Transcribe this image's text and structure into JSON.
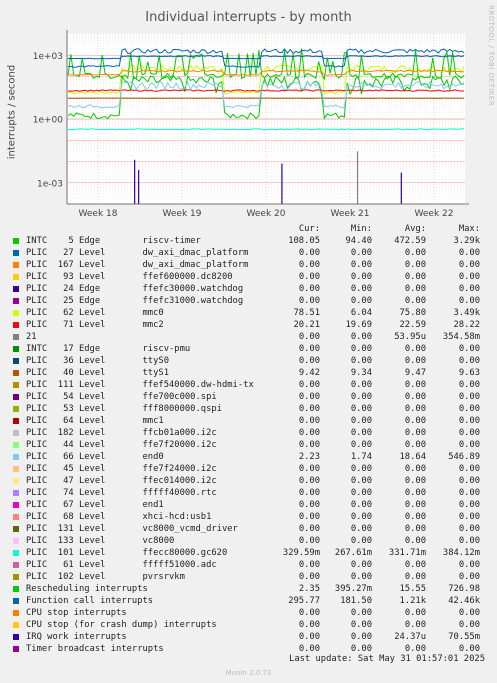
{
  "title": "Individual interrupts - by month",
  "side_credit": "RRDTOOL / TOBI OETIKER",
  "ylabel": "interrupts / second",
  "columns": {
    "cur": "Cur:",
    "min": "Min:",
    "avg": "Avg:",
    "max": "Max:"
  },
  "last_update": "Last update: Sat May 31 01:57:01 2025",
  "version": "Munin 2.0.73",
  "chart_data": {
    "type": "line",
    "title": "Individual interrupts - by month",
    "ylabel": "interrupts / second",
    "yscale": "log",
    "ylim": [
      0.0001,
      10000
    ],
    "yticks": [
      "1e+03",
      "1e+00",
      "1e-03"
    ],
    "xticks": [
      "Week 18",
      "Week 19",
      "Week 20",
      "Week 21",
      "Week 22"
    ],
    "grid": true,
    "series": [
      {
        "name": "INTC    5 Edge        riscv-timer",
        "color": "#00cc00",
        "cur": "108.05",
        "min": "94.40",
        "avg": "472.59",
        "max": "3.29k"
      },
      {
        "name": "PLIC   27 Level       dw_axi_dmac_platform",
        "color": "#0066b3",
        "cur": "0.00",
        "min": "0.00",
        "avg": "0.00",
        "max": "0.00"
      },
      {
        "name": "PLIC  167 Level       dw_axi_dmac_platform",
        "color": "#ff8000",
        "cur": "0.00",
        "min": "0.00",
        "avg": "0.00",
        "max": "0.00"
      },
      {
        "name": "PLIC   93 Level       ffef600000.dc8200",
        "color": "#ffcc00",
        "cur": "0.00",
        "min": "0.00",
        "avg": "0.00",
        "max": "0.00"
      },
      {
        "name": "PLIC   24 Edge        ffefc30000.watchdog",
        "color": "#330099",
        "cur": "0.00",
        "min": "0.00",
        "avg": "0.00",
        "max": "0.00"
      },
      {
        "name": "PLIC   25 Edge        ffefc31000.watchdog",
        "color": "#990099",
        "cur": "0.00",
        "min": "0.00",
        "avg": "0.00",
        "max": "0.00"
      },
      {
        "name": "PLIC   62 Level       mmc0",
        "color": "#ccff00",
        "cur": "78.51",
        "min": "6.04",
        "avg": "75.80",
        "max": "3.49k"
      },
      {
        "name": "PLIC   71 Level       mmc2",
        "color": "#ff0000",
        "cur": "20.21",
        "min": "19.69",
        "avg": "22.59",
        "max": "28.22"
      },
      {
        "name": "21",
        "color": "#808080",
        "cur": "0.00",
        "min": "0.00",
        "avg": "53.95u",
        "max": "354.58m"
      },
      {
        "name": "INTC   17 Edge        riscv-pmu",
        "color": "#008f00",
        "cur": "0.00",
        "min": "0.00",
        "avg": "0.00",
        "max": "0.00"
      },
      {
        "name": "PLIC   36 Level       ttyS0",
        "color": "#00487d",
        "cur": "0.00",
        "min": "0.00",
        "avg": "0.00",
        "max": "0.00"
      },
      {
        "name": "PLIC   40 Level       ttyS1",
        "color": "#b35a00",
        "cur": "9.42",
        "min": "9.34",
        "avg": "9.47",
        "max": "9.63"
      },
      {
        "name": "PLIC  111 Level       ffef540000.dw-hdmi-tx",
        "color": "#b38f00",
        "cur": "0.00",
        "min": "0.00",
        "avg": "0.00",
        "max": "0.00"
      },
      {
        "name": "PLIC   54 Level       ffe700c000.spi",
        "color": "#6b006b",
        "cur": "0.00",
        "min": "0.00",
        "avg": "0.00",
        "max": "0.00"
      },
      {
        "name": "PLIC   53 Level       fff8000000.qspi",
        "color": "#8fb300",
        "cur": "0.00",
        "min": "0.00",
        "avg": "0.00",
        "max": "0.00"
      },
      {
        "name": "PLIC   64 Level       mmc1",
        "color": "#b30000",
        "cur": "0.00",
        "min": "0.00",
        "avg": "0.00",
        "max": "0.00"
      },
      {
        "name": "PLIC  182 Level       ffcb01a000.i2c",
        "color": "#bebebe",
        "cur": "0.00",
        "min": "0.00",
        "avg": "0.00",
        "max": "0.00"
      },
      {
        "name": "PLIC   44 Level       ffe7f20000.i2c",
        "color": "#80ff80",
        "cur": "0.00",
        "min": "0.00",
        "avg": "0.00",
        "max": "0.00"
      },
      {
        "name": "PLIC   66 Level       end0",
        "color": "#80c9ff",
        "cur": "2.23",
        "min": "1.74",
        "avg": "18.64",
        "max": "546.89"
      },
      {
        "name": "PLIC   45 Level       ffe7f24000.i2c",
        "color": "#ffc080",
        "cur": "0.00",
        "min": "0.00",
        "avg": "0.00",
        "max": "0.00"
      },
      {
        "name": "PLIC   47 Level       ffec014000.i2c",
        "color": "#ffe680",
        "cur": "0.00",
        "min": "0.00",
        "avg": "0.00",
        "max": "0.00"
      },
      {
        "name": "PLIC   74 Level       fffff40000.rtc",
        "color": "#aa80ff",
        "cur": "0.00",
        "min": "0.00",
        "avg": "0.00",
        "max": "0.00"
      },
      {
        "name": "PLIC   67 Level       end1",
        "color": "#ee00cc",
        "cur": "0.00",
        "min": "0.00",
        "avg": "0.00",
        "max": "0.00"
      },
      {
        "name": "PLIC   68 Level       xhci-hcd:usb1",
        "color": "#ff8080",
        "cur": "0.00",
        "min": "0.00",
        "avg": "0.00",
        "max": "0.00"
      },
      {
        "name": "PLIC  131 Level       vc8000_vcmd_driver",
        "color": "#666600",
        "cur": "0.00",
        "min": "0.00",
        "avg": "0.00",
        "max": "0.00"
      },
      {
        "name": "PLIC  133 Level       vc8000",
        "color": "#ffbfff",
        "cur": "0.00",
        "min": "0.00",
        "avg": "0.00",
        "max": "0.00"
      },
      {
        "name": "PLIC  101 Level       ffecc80000.gc620",
        "color": "#00ffcc",
        "cur": "329.59m",
        "min": "267.61m",
        "avg": "331.71m",
        "max": "384.12m"
      },
      {
        "name": "PLIC   61 Level       fffff51000.adc",
        "color": "#cc6699",
        "cur": "0.00",
        "min": "0.00",
        "avg": "0.00",
        "max": "0.00"
      },
      {
        "name": "PLIC  102 Level       pvrsrvkm",
        "color": "#999900",
        "cur": "0.00",
        "min": "0.00",
        "avg": "0.00",
        "max": "0.00"
      },
      {
        "name": "Rescheduling interrupts",
        "color": "#00cc00",
        "cur": "2.35",
        "min": "395.27m",
        "avg": "15.55",
        "max": "726.98"
      },
      {
        "name": "Function call interrupts",
        "color": "#0066b3",
        "cur": "295.77",
        "min": "181.50",
        "avg": "1.21k",
        "max": "42.46k"
      },
      {
        "name": "CPU stop interrupts",
        "color": "#ff8000",
        "cur": "0.00",
        "min": "0.00",
        "avg": "0.00",
        "max": "0.00"
      },
      {
        "name": "CPU stop (for crash dump) interrupts",
        "color": "#ffcc00",
        "cur": "0.00",
        "min": "0.00",
        "avg": "0.00",
        "max": "0.00"
      },
      {
        "name": "IRQ work interrupts",
        "color": "#330099",
        "cur": "0.00",
        "min": "0.00",
        "avg": "24.37u",
        "max": "70.55m"
      },
      {
        "name": "Timer broadcast interrupts",
        "color": "#990099",
        "cur": "0.00",
        "min": "0.00",
        "avg": "0.00",
        "max": "0.00"
      }
    ]
  }
}
